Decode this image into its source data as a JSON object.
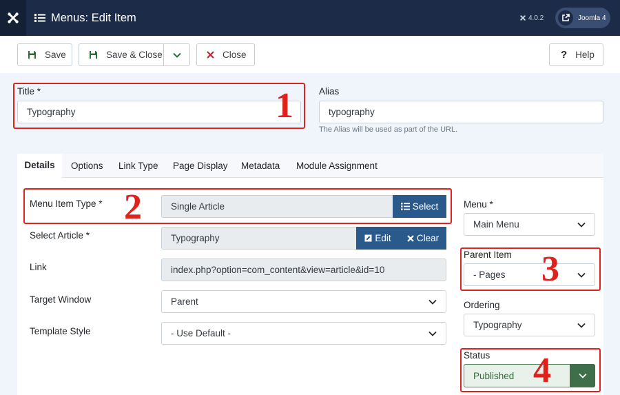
{
  "header": {
    "title": "Menus: Edit Item",
    "version": "4.0.2",
    "site_button": "Joomla 4"
  },
  "toolbar": {
    "save": "Save",
    "save_close": "Save & Close",
    "close": "Close",
    "help": "Help"
  },
  "fields": {
    "title_label": "Title *",
    "title_value": "Typography",
    "alias_label": "Alias",
    "alias_value": "typography",
    "alias_hint": "The Alias will be used as part of the URL."
  },
  "tabs": [
    "Details",
    "Options",
    "Link Type",
    "Page Display",
    "Metadata",
    "Module Assignment"
  ],
  "details": {
    "menu_item_type_label": "Menu Item Type *",
    "menu_item_type_value": "Single Article",
    "select_button": "Select",
    "select_article_label": "Select Article *",
    "select_article_value": "Typography",
    "edit_button": "Edit",
    "clear_button": "Clear",
    "link_label": "Link",
    "link_value": "index.php?option=com_content&view=article&id=10",
    "target_window_label": "Target Window",
    "target_window_value": "Parent",
    "template_style_label": "Template Style",
    "template_style_value": "- Use Default -"
  },
  "sidebar": {
    "menu_label": "Menu *",
    "menu_value": "Main Menu",
    "parent_label": "Parent Item",
    "parent_value": "- Pages",
    "ordering_label": "Ordering",
    "ordering_value": "Typography",
    "status_label": "Status",
    "status_value": "Published"
  },
  "annotations": [
    "1",
    "2",
    "3",
    "4"
  ],
  "colors": {
    "header_bg": "#1c2c48",
    "accent_blue": "#2a5a8c",
    "highlight_red": "#e0221c",
    "status_green": "#3f6e4b"
  },
  "icons": {
    "logo": "joomla-logo-icon",
    "title": "list-icon",
    "save": "floppy-icon",
    "close": "x-icon",
    "help": "question-icon",
    "site": "external-link-icon",
    "dropdown": "chevron-down-icon"
  }
}
